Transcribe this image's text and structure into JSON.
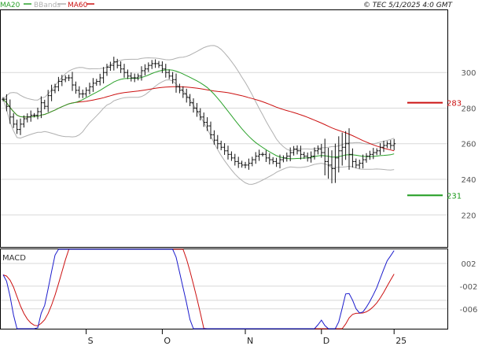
{
  "header": {
    "legend": [
      {
        "name": "MA20",
        "color": "#2aa12a"
      },
      {
        "name": "BBands",
        "color": "#b0b0b0"
      },
      {
        "name": "MA60",
        "color": "#cc1111"
      }
    ],
    "title": "© TEC 5/1/2025 4:0 GMT"
  },
  "macd_panel": {
    "label": "MACD"
  },
  "chart_data": [
    {
      "type": "line",
      "panel": "price",
      "xlabel": "",
      "ylabel": "",
      "ylim": [
        202,
        335
      ],
      "y_ticks": [
        220,
        240,
        260,
        280,
        300
      ],
      "x_ticks": [
        {
          "label": "S",
          "index": 24
        },
        {
          "label": "O",
          "index": 46
        },
        {
          "label": "N",
          "index": 70
        },
        {
          "label": "D",
          "index": 92
        },
        {
          "label": "25",
          "index": 113
        }
      ],
      "grid": true,
      "n_points": 115,
      "price_ohlc": [
        {
          "k": [
            0,
            279
          ],
          "v": [
            285,
            281,
            275,
            271,
            268,
            271,
            274,
            275,
            276,
            276
          ]
        },
        {
          "k": [
            10,
            280
          ],
          "v": [
            278,
            283,
            281,
            287,
            290,
            292,
            295,
            296,
            297,
            297
          ]
        },
        {
          "k": [
            20,
            296
          ],
          "v": [
            293,
            290,
            288,
            288,
            290,
            292,
            294,
            295,
            297,
            300
          ]
        },
        {
          "k": [
            30,
            302
          ],
          "v": [
            303,
            304,
            306,
            304,
            302,
            300,
            298,
            297,
            297,
            298
          ]
        },
        {
          "k": [
            40,
            300
          ],
          "v": [
            301,
            302,
            304,
            305,
            305,
            304,
            302,
            300,
            298,
            296
          ]
        },
        {
          "k": [
            50,
            294
          ],
          "v": [
            292,
            290,
            288,
            286,
            283,
            280,
            278,
            275,
            272,
            270
          ]
        },
        {
          "k": [
            60,
            268
          ],
          "v": [
            265,
            262,
            260,
            258,
            256,
            254,
            252,
            250,
            249,
            248
          ]
        },
        {
          "k": [
            70,
            247
          ],
          "v": [
            248,
            249,
            251,
            253,
            254,
            254,
            252,
            251,
            250,
            249
          ]
        },
        {
          "k": [
            80,
            250
          ],
          "v": [
            251,
            252,
            253,
            255,
            257,
            256,
            254,
            253,
            252,
            253
          ]
        },
        {
          "k": [
            90,
            254
          ],
          "v": [
            256,
            257,
            255,
            250,
            248,
            246,
            252,
            256,
            258,
            260
          ]
        },
        {
          "k": [
            100,
            258
          ],
          "v": [
            254,
            250,
            248,
            249,
            251,
            253,
            254,
            255,
            256,
            258
          ]
        },
        {
          "k": [
            110,
            259
          ],
          "v": [
            259,
            260,
            259,
            260
          ]
        }
      ],
      "series": [
        {
          "name": "MA20",
          "color": "#2aa12a"
        },
        {
          "name": "BBands",
          "color": "#b0b0b0"
        },
        {
          "name": "MA60",
          "color": "#cc1111"
        }
      ],
      "markers": [
        {
          "label": "283",
          "value": 283,
          "color": "#cc1111"
        },
        {
          "label": "231",
          "value": 231,
          "color": "#1a9a1a"
        }
      ]
    },
    {
      "type": "line",
      "panel": "macd",
      "ylabel": "",
      "y_ticks": [
        {
          "label": "002",
          "value": 0.002
        },
        {
          "label": "-002",
          "value": -0.002
        },
        {
          "label": "-006",
          "value": -0.006
        }
      ],
      "series": [
        {
          "name": "",
          "color": "#1a1acc"
        },
        {
          "name": "",
          "color": "#cc1111"
        }
      ]
    }
  ]
}
